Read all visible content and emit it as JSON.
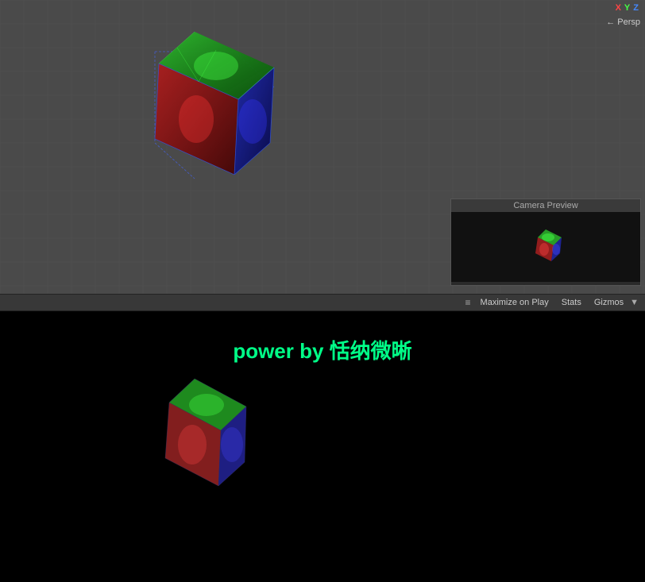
{
  "scene": {
    "persp_label": "← Persp",
    "axis": {
      "x_label": "X",
      "y_label": "Y",
      "z_label": "Z"
    },
    "camera_preview_title": "Camera Preview"
  },
  "toolbar": {
    "maximize_label": "Maximize on Play",
    "stats_label": "Stats",
    "gizmos_label": "Gizmos"
  },
  "game": {
    "power_text": "power by 恬纳微晰"
  }
}
